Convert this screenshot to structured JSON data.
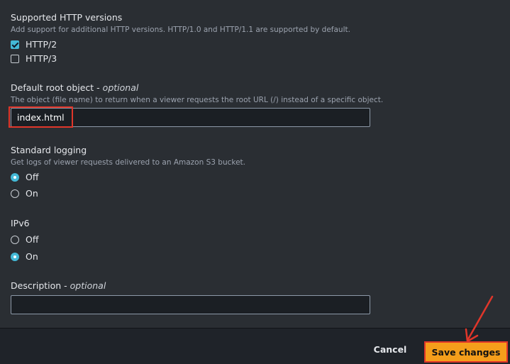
{
  "http_versions": {
    "label": "Supported HTTP versions",
    "description": "Add support for additional HTTP versions. HTTP/1.0 and HTTP/1.1 are supported by default.",
    "options": [
      {
        "label": "HTTP/2",
        "checked": true
      },
      {
        "label": "HTTP/3",
        "checked": false
      }
    ]
  },
  "root_object": {
    "label": "Default root object - ",
    "optional": "optional",
    "description": "The object (file name) to return when a viewer requests the root URL (/) instead of a specific object.",
    "value": "index.html"
  },
  "standard_logging": {
    "label": "Standard logging",
    "description": "Get logs of viewer requests delivered to an Amazon S3 bucket.",
    "options": [
      {
        "label": "Off",
        "checked": true
      },
      {
        "label": "On",
        "checked": false
      }
    ]
  },
  "ipv6": {
    "label": "IPv6",
    "options": [
      {
        "label": "Off",
        "checked": false
      },
      {
        "label": "On",
        "checked": true
      }
    ]
  },
  "description_field": {
    "label": "Description - ",
    "optional": "optional",
    "value": ""
  },
  "footer": {
    "cancel_label": "Cancel",
    "save_label": "Save changes"
  },
  "colors": {
    "accent": "#44b9d6",
    "primary_button": "#f59e1b",
    "annotation": "#e0362a"
  },
  "icons": [
    "checkbox-checked-icon",
    "checkbox-icon",
    "radio-selected-icon",
    "radio-icon",
    "annotation-arrow-icon"
  ]
}
